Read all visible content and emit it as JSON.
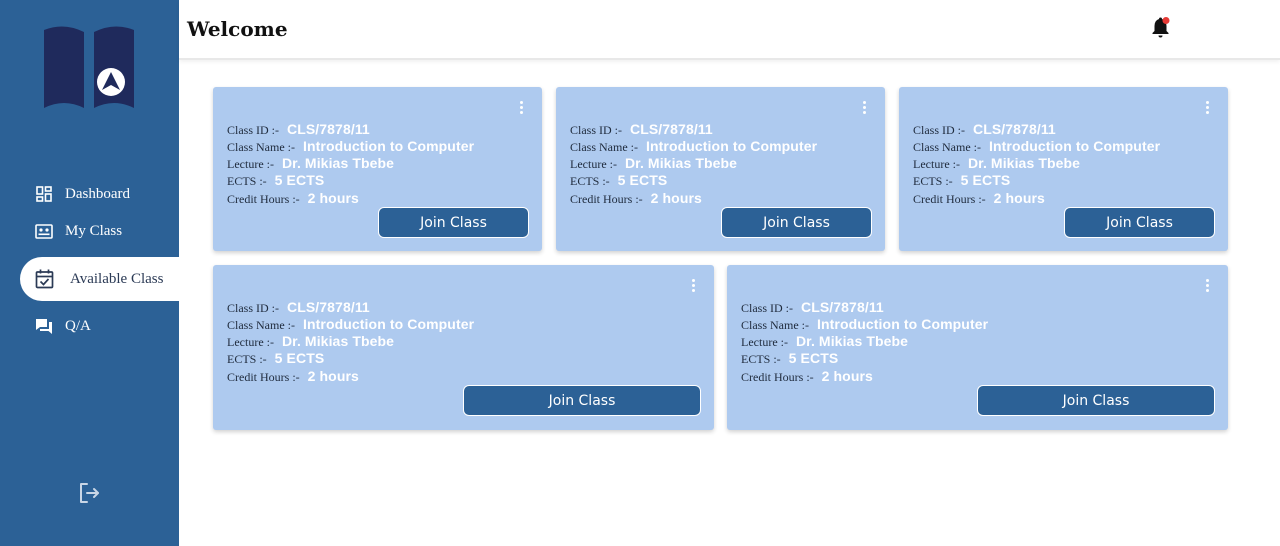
{
  "header": {
    "title": "Welcome"
  },
  "sidebar": {
    "items": [
      {
        "label": "Dashboard",
        "icon": "dashboard-icon"
      },
      {
        "label": "My Class",
        "icon": "class-icon"
      },
      {
        "label": "Available Class",
        "icon": "calendar-check-icon",
        "active": true
      },
      {
        "label": "Q/A",
        "icon": "forum-icon"
      }
    ]
  },
  "fields": {
    "class_id": "Class ID :-",
    "class_name": "Class Name :-",
    "lecture": "Lecture :-",
    "ects": "ECTS :-",
    "credit_hours": "Credit Hours :-"
  },
  "cards": [
    {
      "class_id": "CLS/7878/11",
      "class_name": "Introduction to Computer",
      "lecture": "Dr. Mikias Tbebe",
      "ects": "5 ECTS",
      "credit_hours": "2 hours",
      "button": "Join Class"
    },
    {
      "class_id": "CLS/7878/11",
      "class_name": "Introduction to Computer",
      "lecture": "Dr. Mikias Tbebe",
      "ects": "5 ECTS",
      "credit_hours": "2 hours",
      "button": "Join Class"
    },
    {
      "class_id": "CLS/7878/11",
      "class_name": "Introduction to Computer",
      "lecture": "Dr. Mikias Tbebe",
      "ects": "5 ECTS",
      "credit_hours": "2 hours",
      "button": "Join Class"
    },
    {
      "class_id": "CLS/7878/11",
      "class_name": "Introduction to Computer",
      "lecture": "Dr. Mikias Tbebe",
      "ects": "5 ECTS",
      "credit_hours": "2 hours",
      "button": "Join Class"
    },
    {
      "class_id": "CLS/7878/11",
      "class_name": "Introduction to Computer",
      "lecture": "Dr. Mikias Tbebe",
      "ects": "5 ECTS",
      "credit_hours": "2 hours",
      "button": "Join Class"
    }
  ],
  "colors": {
    "sidebar": "#2c6196",
    "card": "#aecaef",
    "button": "#2c6196",
    "logo": "#1f2a5c",
    "notification_dot": "#e53935"
  }
}
